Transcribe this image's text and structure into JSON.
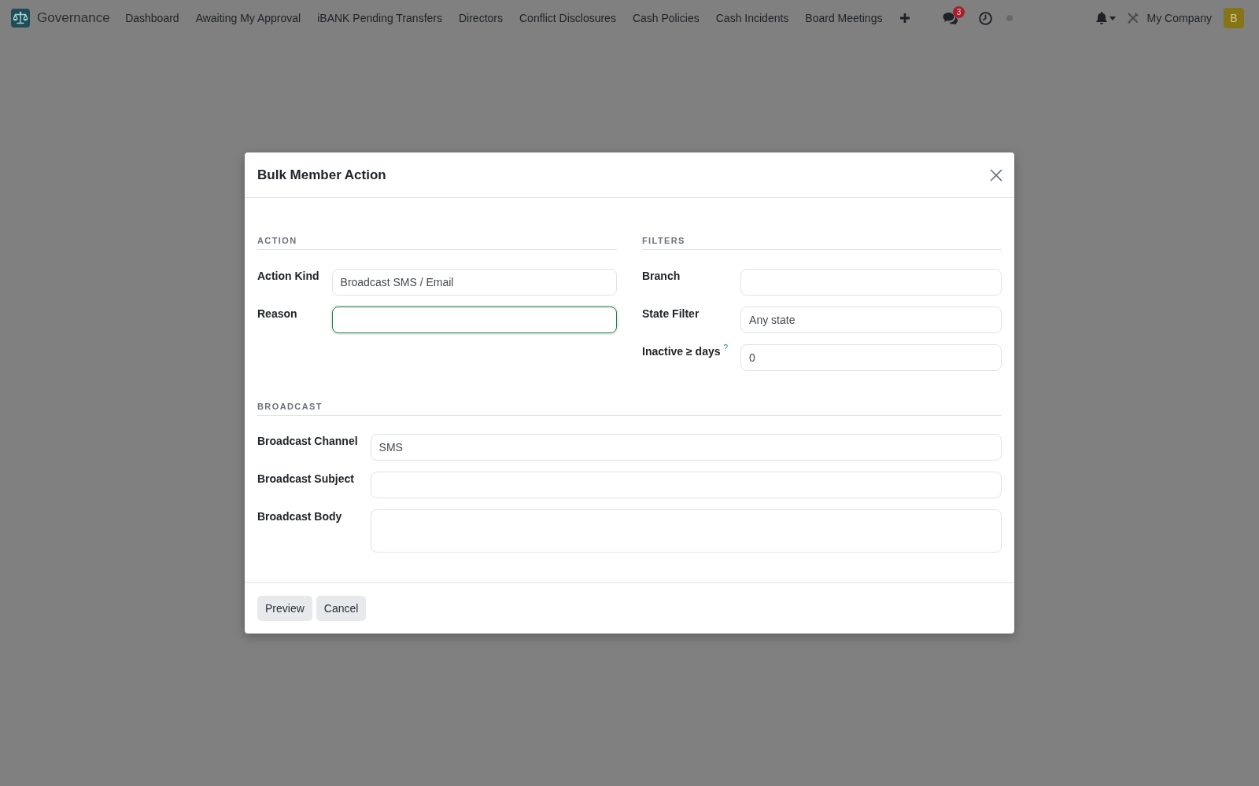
{
  "navbar": {
    "app_name": "Governance",
    "menu": [
      "Dashboard",
      "Awaiting My Approval",
      "iBANK Pending Transfers",
      "Directors",
      "Conflict Disclosures",
      "Cash Policies",
      "Cash Incidents",
      "Board Meetings"
    ],
    "message_count": "3",
    "company": "My Company",
    "avatar_initial": "B"
  },
  "dialog": {
    "title": "Bulk Member Action",
    "sections": [
      {
        "kind": "half",
        "heading": "ACTION",
        "fields": [
          {
            "kind": "input",
            "label": "Action Kind",
            "value": "Broadcast SMS / Email",
            "focused": false
          },
          {
            "kind": "input",
            "label": "Reason",
            "focused": true
          }
        ]
      },
      {
        "kind": "half",
        "heading": "FILTERS",
        "fields": [
          {
            "kind": "input",
            "label": "Branch",
            "focused": false
          },
          {
            "kind": "input",
            "label": "State Filter",
            "value": "Any state",
            "focused": false
          },
          {
            "kind": "input",
            "label": "Inactive ≥ days",
            "help": "?",
            "value": "0",
            "focused": false
          }
        ]
      },
      {
        "kind": "full",
        "heading": "BROADCAST",
        "fields": [
          {
            "kind": "input",
            "label": "Broadcast Channel",
            "value": "SMS",
            "focused": false
          },
          {
            "kind": "input",
            "label": "Broadcast Subject",
            "focused": false
          },
          {
            "kind": "textarea",
            "label": "Broadcast Body",
            "focused": false
          }
        ]
      }
    ],
    "buttons": [
      "Preview",
      "Cancel"
    ]
  }
}
